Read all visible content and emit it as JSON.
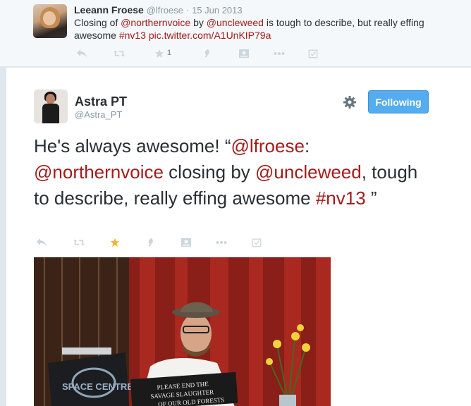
{
  "parent_tweet": {
    "fullname": "Leeann Froese",
    "username": "@lfroese",
    "separator": "·",
    "time": "15 Jun 2013",
    "text_parts": [
      {
        "t": "Closing of ",
        "link": false
      },
      {
        "t": "@northernvoice",
        "link": true
      },
      {
        "t": " by ",
        "link": false
      },
      {
        "t": "@uncleweed",
        "link": true
      },
      {
        "t": " is tough to describe, but really effing awesome ",
        "link": false
      },
      {
        "t": "#nv13",
        "link": true
      },
      {
        "t": " ",
        "link": false
      },
      {
        "t": "pic.twitter.com/A1UnKIP79a",
        "link": true
      }
    ],
    "favorite_count": "1",
    "actions": [
      "reply-icon",
      "retweet-icon",
      "favorite-icon",
      "vine-icon",
      "media-icon",
      "more-icon",
      "check-icon"
    ]
  },
  "main_tweet": {
    "fullname": "Astra PT",
    "username": "@Astra_PT",
    "follow_label": "Following",
    "text_parts": [
      {
        "t": "He's always awesome! “",
        "link": false
      },
      {
        "t": "@lfroese",
        "link": true
      },
      {
        "t": ": ",
        "link": false
      },
      {
        "t": "@northernvoice",
        "link": true
      },
      {
        "t": " closing by ",
        "link": false
      },
      {
        "t": "@uncleweed",
        "link": true
      },
      {
        "t": ", tough to describe, really effing awesome ",
        "link": false
      },
      {
        "t": "#nv13",
        "link": true
      },
      {
        "t": " ”",
        "link": false
      }
    ],
    "favorited": true,
    "photo_sign_text": "PLEASE END THE SAVAGE SLAUGHTER OF OUR OLD FORESTS",
    "podium_text": "SPACE CENTRE"
  },
  "colors": {
    "link": "#a31c1c",
    "follow_bg": "#55acee",
    "favorite_active": "#ffac33",
    "icon_gray": "#ccd6dd"
  }
}
